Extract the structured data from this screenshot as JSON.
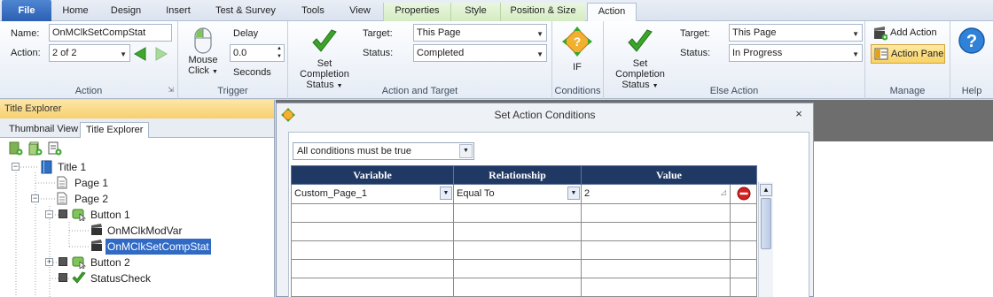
{
  "tabs": [
    {
      "label": "File"
    },
    {
      "label": "Home"
    },
    {
      "label": "Design"
    },
    {
      "label": "Insert"
    },
    {
      "label": "Test & Survey"
    },
    {
      "label": "Tools"
    },
    {
      "label": "View"
    },
    {
      "label": "Properties"
    },
    {
      "label": "Style"
    },
    {
      "label": "Position & Size"
    },
    {
      "label": "Action"
    }
  ],
  "ribbon": {
    "action": {
      "name_label": "Name:",
      "name_value": "OnMClkSetCompStat",
      "action_label": "Action:",
      "action_value": "2 of 2",
      "group_label": "Action"
    },
    "trigger": {
      "mouse_label": "Mouse",
      "click_label": "Click",
      "delay_label": "Delay",
      "delay_value": "0.0",
      "seconds_label": "Seconds",
      "group_label": "Trigger"
    },
    "action_target": {
      "btn_line1": "Set Completion",
      "btn_line2": "Status",
      "target_label": "Target:",
      "target_value": "This Page",
      "status_label": "Status:",
      "status_value": "Completed",
      "group_label": "Action and Target"
    },
    "conditions": {
      "if_label": "IF",
      "group_label": "Conditions"
    },
    "else_action": {
      "btn_line1": "Set Completion",
      "btn_line2": "Status",
      "target_label": "Target:",
      "target_value": "This Page",
      "status_label": "Status:",
      "status_value": "In Progress",
      "group_label": "Else Action"
    },
    "manage": {
      "add_action": "Add Action",
      "action_pane": "Action Pane",
      "group_label": "Manage"
    },
    "help": {
      "group_label": "Help"
    }
  },
  "explorer": {
    "header": "Title Explorer",
    "tab_thumbnail": "Thumbnail View",
    "tab_title": "Title Explorer",
    "nodes": {
      "title1": "Title 1",
      "page1": "Page 1",
      "page2": "Page 2",
      "button1": "Button 1",
      "modvar": "OnMClkModVar",
      "setcomp": "OnMClkSetCompStat",
      "button2": "Button 2",
      "statuscheck": "StatusCheck"
    }
  },
  "dialog": {
    "title": "Set Action Conditions",
    "close": "×",
    "mode": "All conditions must be true",
    "columns": [
      "Variable",
      "Relationship",
      "Value"
    ],
    "rows": [
      {
        "variable": "Custom_Page_1",
        "relationship": "Equal To",
        "value": "2"
      }
    ]
  },
  "colors": {
    "file_tab": "#2b5fb3",
    "table_header": "#203864",
    "selection": "#316ac5",
    "explorer_header": "#f7cf6f"
  }
}
